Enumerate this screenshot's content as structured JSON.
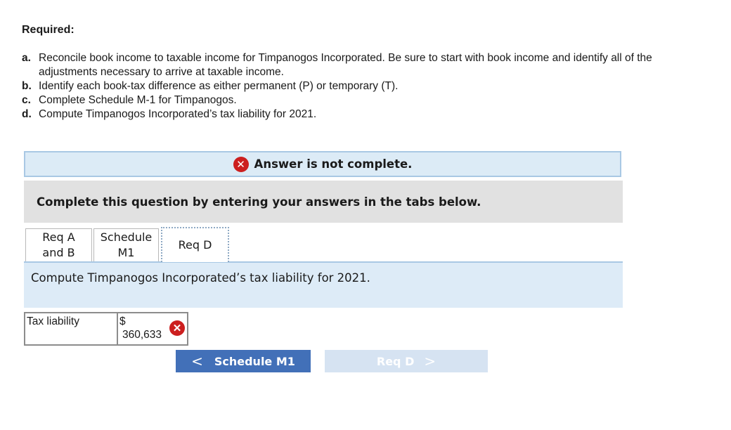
{
  "required": {
    "title": "Required:",
    "items": [
      {
        "letter": "a.",
        "text": "Reconcile book income to taxable income for Timpanogos Incorporated. Be sure to start with book income and identify all of the adjustments necessary to arrive at taxable income."
      },
      {
        "letter": "b.",
        "text": "Identify each book-tax difference as either permanent (P) or temporary (T)."
      },
      {
        "letter": "c.",
        "text": "Complete Schedule M-1 for Timpanogos."
      },
      {
        "letter": "d.",
        "text": "Compute Timpanogos Incorporated’s tax liability for 2021."
      }
    ]
  },
  "status": {
    "message": "Answer is not complete.",
    "icon": "x-circle-icon",
    "color": "#cc1f1f"
  },
  "instructions": "Complete this question by entering your answers in the tabs below.",
  "tabs": [
    {
      "line1": "Req A",
      "line2": "and B"
    },
    {
      "line1": "Schedule",
      "line2": "M1"
    },
    {
      "line1": "Req D",
      "line2": ""
    }
  ],
  "active_tab": "Req D",
  "panel": {
    "prompt": "Compute Timpanogos Incorporated’s tax liability for 2021."
  },
  "answer_row": {
    "label": "Tax liability",
    "currency": "$",
    "value": "360,633",
    "result": "incorrect"
  },
  "nav": {
    "prev_label": "Schedule M1",
    "next_label": "Req D",
    "prev_color": "#4270b8",
    "next_color": "#d6e3f2"
  }
}
